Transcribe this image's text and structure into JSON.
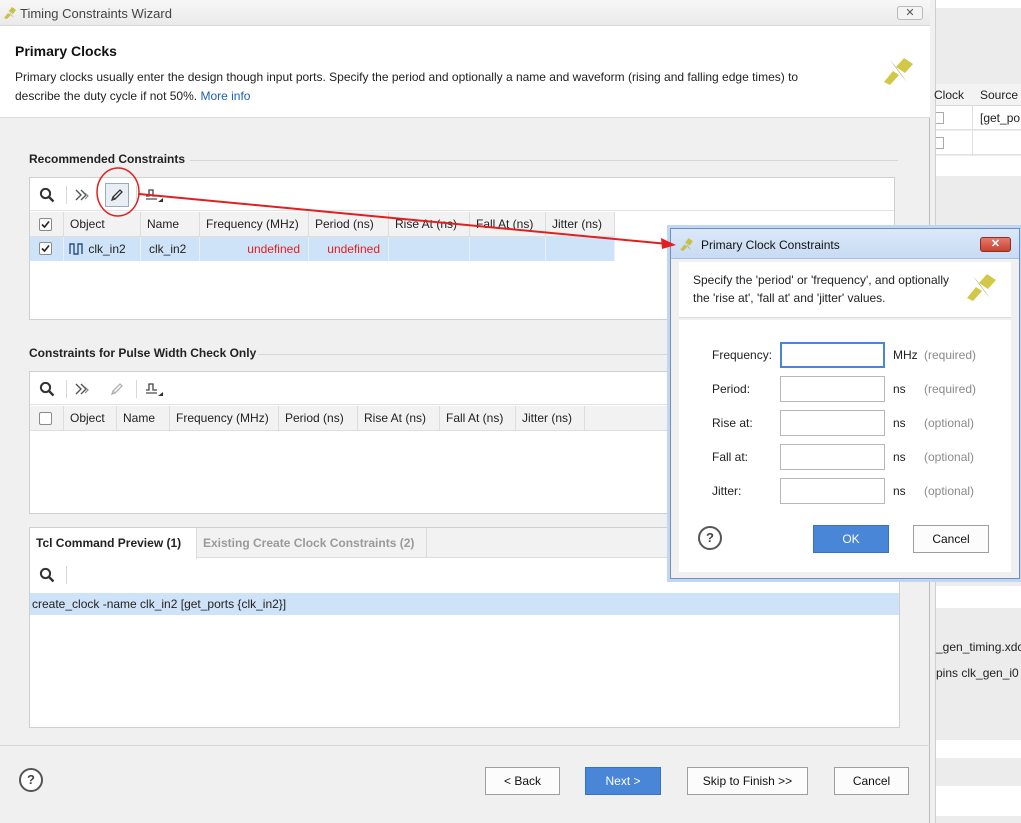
{
  "background_app": {
    "header": {
      "col1": "Clock",
      "col2": "Source"
    },
    "row1_source": "[get_po",
    "file_text": "_gen_timing.xdc",
    "pins_text": "pins clk_gen_i0"
  },
  "wizard": {
    "title": "Timing Constraints Wizard",
    "heading": "Primary Clocks",
    "description": "Primary clocks usually enter the design though input ports. Specify the period and optionally a name and waveform (rising and falling edge times) to describe the duty cycle if not 50%.",
    "more_info": "More info",
    "recommended": {
      "label": "Recommended Constraints",
      "columns": [
        "Object",
        "Name",
        "Frequency (MHz)",
        "Period (ns)",
        "Rise At (ns)",
        "Fall At (ns)",
        "Jitter (ns)"
      ],
      "rows": [
        {
          "checked": true,
          "object": "clk_in2",
          "name": "clk_in2",
          "frequency": "undefined",
          "period": "undefined",
          "rise_at": "",
          "fall_at": "",
          "jitter": ""
        }
      ]
    },
    "pulse_width": {
      "label": "Constraints for Pulse Width Check Only",
      "columns": [
        "Object",
        "Name",
        "Frequency (MHz)",
        "Period (ns)",
        "Rise At (ns)",
        "Fall At (ns)",
        "Jitter (ns)"
      ]
    },
    "tabs": [
      {
        "label": "Tcl Command Preview (1)",
        "active": true
      },
      {
        "label": "Existing Create Clock Constraints (2)",
        "active": false
      }
    ],
    "tcl_command": "create_clock -name clk_in2 [get_ports {clk_in2}]",
    "buttons": {
      "back": "< Back",
      "next": "Next >",
      "skip": "Skip to Finish >>",
      "cancel": "Cancel"
    }
  },
  "dialog": {
    "title": "Primary Clock Constraints",
    "description": "Specify the 'period' or 'frequency', and optionally the 'rise at', 'fall at' and 'jitter' values.",
    "fields": [
      {
        "label": "Frequency:",
        "value": "",
        "unit": "MHz",
        "note": "(required)"
      },
      {
        "label": "Period:",
        "value": "",
        "unit": "ns",
        "note": "(required)"
      },
      {
        "label": "Rise at:",
        "value": "",
        "unit": "ns",
        "note": "(optional)"
      },
      {
        "label": "Fall at:",
        "value": "",
        "unit": "ns",
        "note": "(optional)"
      },
      {
        "label": "Jitter:",
        "value": "",
        "unit": "ns",
        "note": "(optional)"
      }
    ],
    "ok": "OK",
    "cancel": "Cancel"
  },
  "colors": {
    "accent": "#4a86d8",
    "annotation": "#e02020",
    "selection": "#cfe3f8",
    "link": "#1c5fbd"
  }
}
